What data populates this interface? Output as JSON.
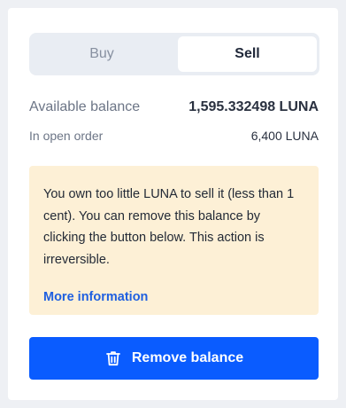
{
  "tabs": {
    "buy_label": "Buy",
    "sell_label": "Sell",
    "active": "Sell"
  },
  "balances": {
    "available_label": "Available balance",
    "available_value": "1,595.332498 LUNA",
    "open_order_label": "In open order",
    "open_order_value": "6,400 LUNA"
  },
  "warning": {
    "message": "You own too little LUNA to sell it (less than 1 cent). You can remove this balance by clicking the button below. This action is irreversible.",
    "link_label": "More information"
  },
  "action": {
    "icon": "trash-icon",
    "label": "Remove balance"
  },
  "colors": {
    "primary": "#0a5cff",
    "link": "#1e5fe0",
    "warning_bg": "#fdf0d6"
  }
}
